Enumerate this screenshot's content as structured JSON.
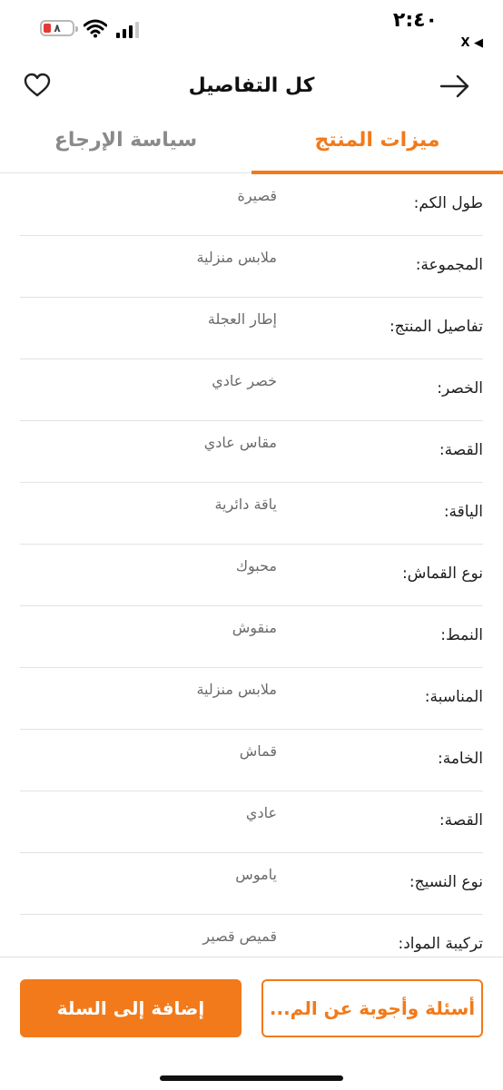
{
  "status_bar": {
    "time": "٢:٤٠",
    "back_label": "X ◀",
    "battery": "٨"
  },
  "header": {
    "title": "كل التفاصيل",
    "icons": {
      "favorite": "heart-icon",
      "back": "arrow-right-icon"
    }
  },
  "tabs": [
    {
      "label": "ميزات المنتج",
      "active": true
    },
    {
      "label": "سياسة الإرجاع",
      "active": false
    }
  ],
  "attributes": [
    {
      "label": "طول الكم:",
      "value": "قصيرة"
    },
    {
      "label": "المجموعة:",
      "value": "ملابس منزلية"
    },
    {
      "label": "تفاصيل المنتج:",
      "value": "إطار العجلة"
    },
    {
      "label": "الخصر:",
      "value": "خصر عادي"
    },
    {
      "label": "القصة:",
      "value": "مقاس عادي"
    },
    {
      "label": "الياقة:",
      "value": "ياقة دائرية"
    },
    {
      "label": "نوع القماش:",
      "value": "محبوك"
    },
    {
      "label": "النمط:",
      "value": "منقوش"
    },
    {
      "label": "المناسبة:",
      "value": "ملابس منزلية"
    },
    {
      "label": "الخامة:",
      "value": "قماش"
    },
    {
      "label": "القصة:",
      "value": "عادي"
    },
    {
      "label": "نوع النسيج:",
      "value": "ياموس"
    },
    {
      "label": "تركيبة المواد:",
      "value": "قميص قصير"
    }
  ],
  "bottom": {
    "qa_button": "أسئلة وأجوبة عن الم...",
    "add_to_cart_button": "إضافة إلى السلة"
  },
  "colors": {
    "accent": "#f27a1a",
    "battery_low": "#e53935"
  }
}
